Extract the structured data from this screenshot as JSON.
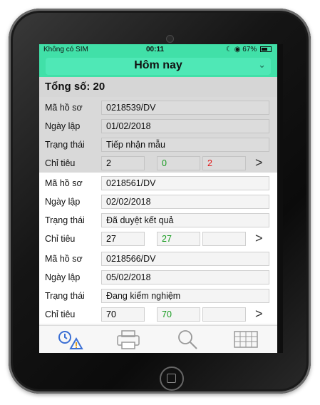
{
  "status_bar": {
    "carrier": "Không có SIM",
    "wifi": "wifi-icon",
    "time": "00:11",
    "battery_percent": "67%"
  },
  "header": {
    "title": "Hôm nay",
    "chevron": "chevron-down-icon"
  },
  "summary": {
    "total_label": "Tổng số: 20"
  },
  "labels": {
    "record_id": "Mã hồ sơ",
    "created_date": "Ngày lập",
    "status": "Trạng thái",
    "targets": "Chỉ tiêu"
  },
  "records": [
    {
      "record_id": "0218539/DV",
      "created_date": "01/02/2018",
      "status": "Tiếp nhận mẫu",
      "target_total": "2",
      "target_ok": "0",
      "target_fail": "2"
    },
    {
      "record_id": "0218561/DV",
      "created_date": "02/02/2018",
      "status": "Đã duyệt kết quả",
      "target_total": "27",
      "target_ok": "27",
      "target_fail": ""
    },
    {
      "record_id": "0218566/DV",
      "created_date": "05/02/2018",
      "status": "Đang kiểm nghiệm",
      "target_total": "70",
      "target_ok": "70",
      "target_fail": ""
    }
  ],
  "tabs": [
    {
      "name": "alert-clock-icon"
    },
    {
      "name": "printer-icon"
    },
    {
      "name": "search-icon"
    },
    {
      "name": "grid-icon"
    }
  ],
  "colors": {
    "accent": "#41e0a8",
    "ok": "#159a1d",
    "fail": "#e01818"
  }
}
